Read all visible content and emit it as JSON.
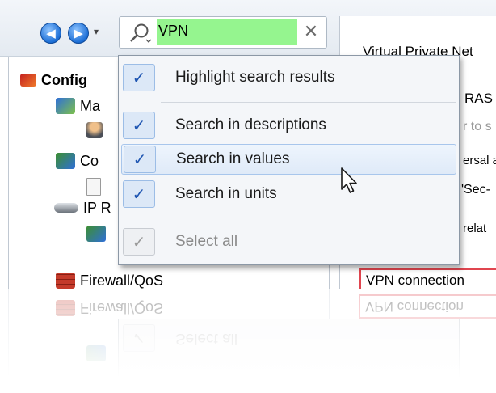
{
  "toolbar": {
    "back_icon": "back-arrow-icon",
    "forward_icon": "forward-arrow-icon",
    "history_dropdown_glyph": "▾",
    "search": {
      "value": "VPN",
      "icon": "search-icon",
      "clear_glyph": "✕"
    }
  },
  "tree": {
    "items": [
      {
        "label": "Config",
        "icon": "config-icon",
        "bold": true
      },
      {
        "label": "Ma",
        "icon": "management-icon"
      },
      {
        "label": "",
        "icon": "user-icon"
      },
      {
        "label": "Co",
        "icon": "communication-icon"
      },
      {
        "label": "",
        "icon": "document-icon"
      },
      {
        "label": "IP R",
        "icon": "router-icon"
      },
      {
        "label": "",
        "icon": "network-icon"
      },
      {
        "label": "Firewall/QoS",
        "icon": "firewall-icon"
      }
    ]
  },
  "right_panel": {
    "lines": [
      {
        "text": "Virtual Private Net"
      },
      {
        "text": "RAS"
      },
      {
        "text": "r to s",
        "gray": true
      },
      {
        "text": "ersal a"
      },
      {
        "text": "'Sec-"
      },
      {
        "text": "relat"
      },
      {
        "text": "VPN connection"
      }
    ]
  },
  "menu": {
    "items": [
      {
        "label": "Highlight search results",
        "checked": true,
        "enabled": true
      },
      {
        "label": "Search in descriptions",
        "checked": true,
        "enabled": true
      },
      {
        "label": "Search in values",
        "checked": true,
        "enabled": true,
        "hovered": true
      },
      {
        "label": "Search in units",
        "checked": true,
        "enabled": true
      },
      {
        "label": "Select all",
        "checked": true,
        "enabled": false
      }
    ],
    "check_glyph": "✓"
  },
  "colors": {
    "search_highlight": "#95f58f",
    "check_accent": "#1f56b2",
    "vpn_border": "#e0454f"
  }
}
